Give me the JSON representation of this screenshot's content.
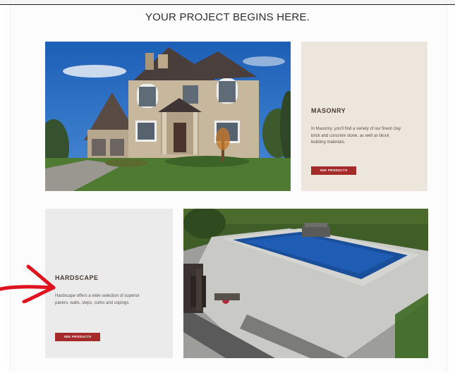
{
  "header": {
    "title": "YOUR PROJECT BEGINS HERE."
  },
  "masonry": {
    "title": "MASONRY",
    "description": "In Masonry, you'll find a variety of our finest clay brick and concrete stone, as well as block building materials.",
    "button_label": "SEE PRODUCTS"
  },
  "hardscape": {
    "title": "HARDSCAPE",
    "description": "Hardscape offers a wide selection of superior pavers, walls, steps, curbs and copings.",
    "button_label": "SEE PRODUCTS"
  },
  "colors": {
    "accent": "#a52a2a",
    "masonry_card_bg": "#ede6dd",
    "hardscape_card_bg": "#ebebeb",
    "annotation_arrow": "#e0141e"
  },
  "icons": {
    "annotation": "red-arrow-icon"
  }
}
